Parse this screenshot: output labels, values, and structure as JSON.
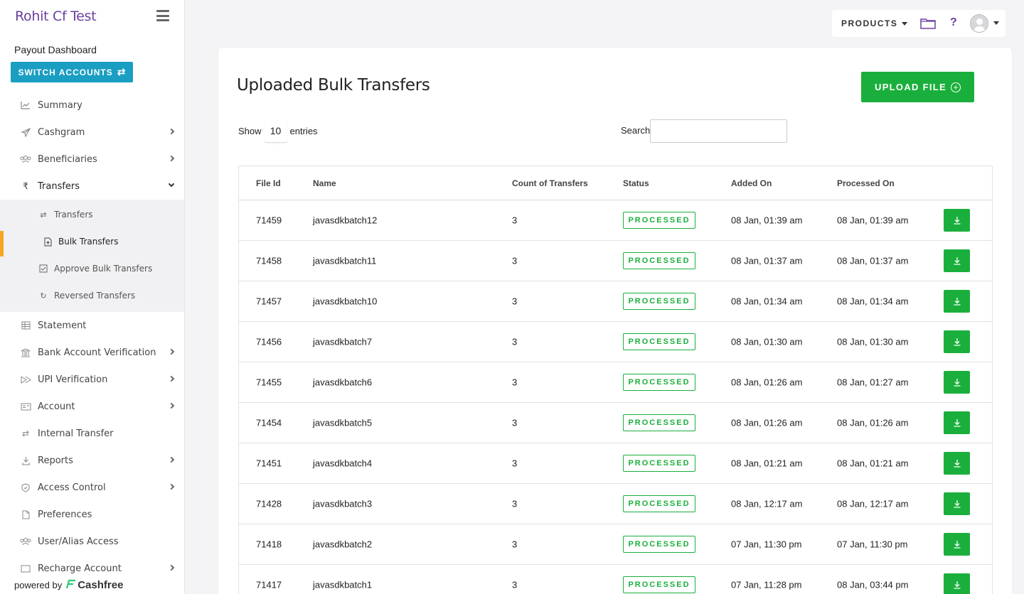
{
  "app": {
    "brand": "Rohit Cf Test"
  },
  "sidebar": {
    "dashboard_title": "Payout Dashboard",
    "switch_label": "SWITCH ACCOUNTS",
    "items": [
      {
        "label": "Summary",
        "icon": "chart-line-icon"
      },
      {
        "label": "Cashgram",
        "icon": "paper-plane-icon"
      },
      {
        "label": "Beneficiaries",
        "icon": "users-icon"
      },
      {
        "label": "Transfers",
        "icon": "rupee-icon"
      },
      {
        "label": "Statement",
        "icon": "table-icon"
      },
      {
        "label": "Bank Account Verification",
        "icon": "bank-icon"
      },
      {
        "label": "UPI Verification",
        "icon": "upi-icon"
      },
      {
        "label": "Account",
        "icon": "id-card-icon"
      },
      {
        "label": "Internal Transfer",
        "icon": "swap-icon"
      },
      {
        "label": "Reports",
        "icon": "reports-icon"
      },
      {
        "label": "Access Control",
        "icon": "shield-icon"
      },
      {
        "label": "Preferences",
        "icon": "file-icon"
      },
      {
        "label": "User/Alias Access",
        "icon": "users-icon"
      },
      {
        "label": "Recharge Account",
        "icon": "wallet-icon"
      }
    ],
    "sub_items": [
      {
        "label": "Transfers",
        "icon": "swap-icon"
      },
      {
        "label": "Bulk Transfers",
        "icon": "file-upload-icon"
      },
      {
        "label": "Approve Bulk Transfers",
        "icon": "check-square-icon"
      },
      {
        "label": "Reversed Transfers",
        "icon": "refresh-icon"
      }
    ],
    "powered_by": "powered by",
    "powered_brand": "Cashfree"
  },
  "topbar": {
    "products_label": "PRODUCTS",
    "help_label": "?"
  },
  "main": {
    "title": "Uploaded Bulk Transfers",
    "upload_label": "UPLOAD FILE",
    "show_label": "Show",
    "entries_value": "10",
    "entries_label": "entries",
    "search_label": "Search:",
    "search_value": ""
  },
  "table": {
    "headers": [
      "File Id",
      "Name",
      "Count of Transfers",
      "Status",
      "Added On",
      "Processed On"
    ],
    "rows": [
      {
        "id": "71459",
        "name": "javasdkbatch12",
        "count": "3",
        "status": "PROCESSED",
        "added": "08 Jan, 01:39 am",
        "processed": "08 Jan, 01:39 am"
      },
      {
        "id": "71458",
        "name": "javasdkbatch11",
        "count": "3",
        "status": "PROCESSED",
        "added": "08 Jan, 01:37 am",
        "processed": "08 Jan, 01:37 am"
      },
      {
        "id": "71457",
        "name": "javasdkbatch10",
        "count": "3",
        "status": "PROCESSED",
        "added": "08 Jan, 01:34 am",
        "processed": "08 Jan, 01:34 am"
      },
      {
        "id": "71456",
        "name": "javasdkbatch7",
        "count": "3",
        "status": "PROCESSED",
        "added": "08 Jan, 01:30 am",
        "processed": "08 Jan, 01:30 am"
      },
      {
        "id": "71455",
        "name": "javasdkbatch6",
        "count": "3",
        "status": "PROCESSED",
        "added": "08 Jan, 01:26 am",
        "processed": "08 Jan, 01:27 am"
      },
      {
        "id": "71454",
        "name": "javasdkbatch5",
        "count": "3",
        "status": "PROCESSED",
        "added": "08 Jan, 01:26 am",
        "processed": "08 Jan, 01:26 am"
      },
      {
        "id": "71451",
        "name": "javasdkbatch4",
        "count": "3",
        "status": "PROCESSED",
        "added": "08 Jan, 01:21 am",
        "processed": "08 Jan, 01:21 am"
      },
      {
        "id": "71428",
        "name": "javasdkbatch3",
        "count": "3",
        "status": "PROCESSED",
        "added": "08 Jan, 12:17 am",
        "processed": "08 Jan, 12:17 am"
      },
      {
        "id": "71418",
        "name": "javasdkbatch2",
        "count": "3",
        "status": "PROCESSED",
        "added": "07 Jan, 11:30 pm",
        "processed": "07 Jan, 11:30 pm"
      },
      {
        "id": "71417",
        "name": "javasdkbatch1",
        "count": "3",
        "status": "PROCESSED",
        "added": "07 Jan, 11:28 pm",
        "processed": "08 Jan, 03:44 pm"
      }
    ]
  },
  "colors": {
    "brand": "#6b3fa0",
    "accent_blue": "#1a9ec2",
    "success": "#1aaf3c",
    "active_marker": "#f5a623"
  }
}
